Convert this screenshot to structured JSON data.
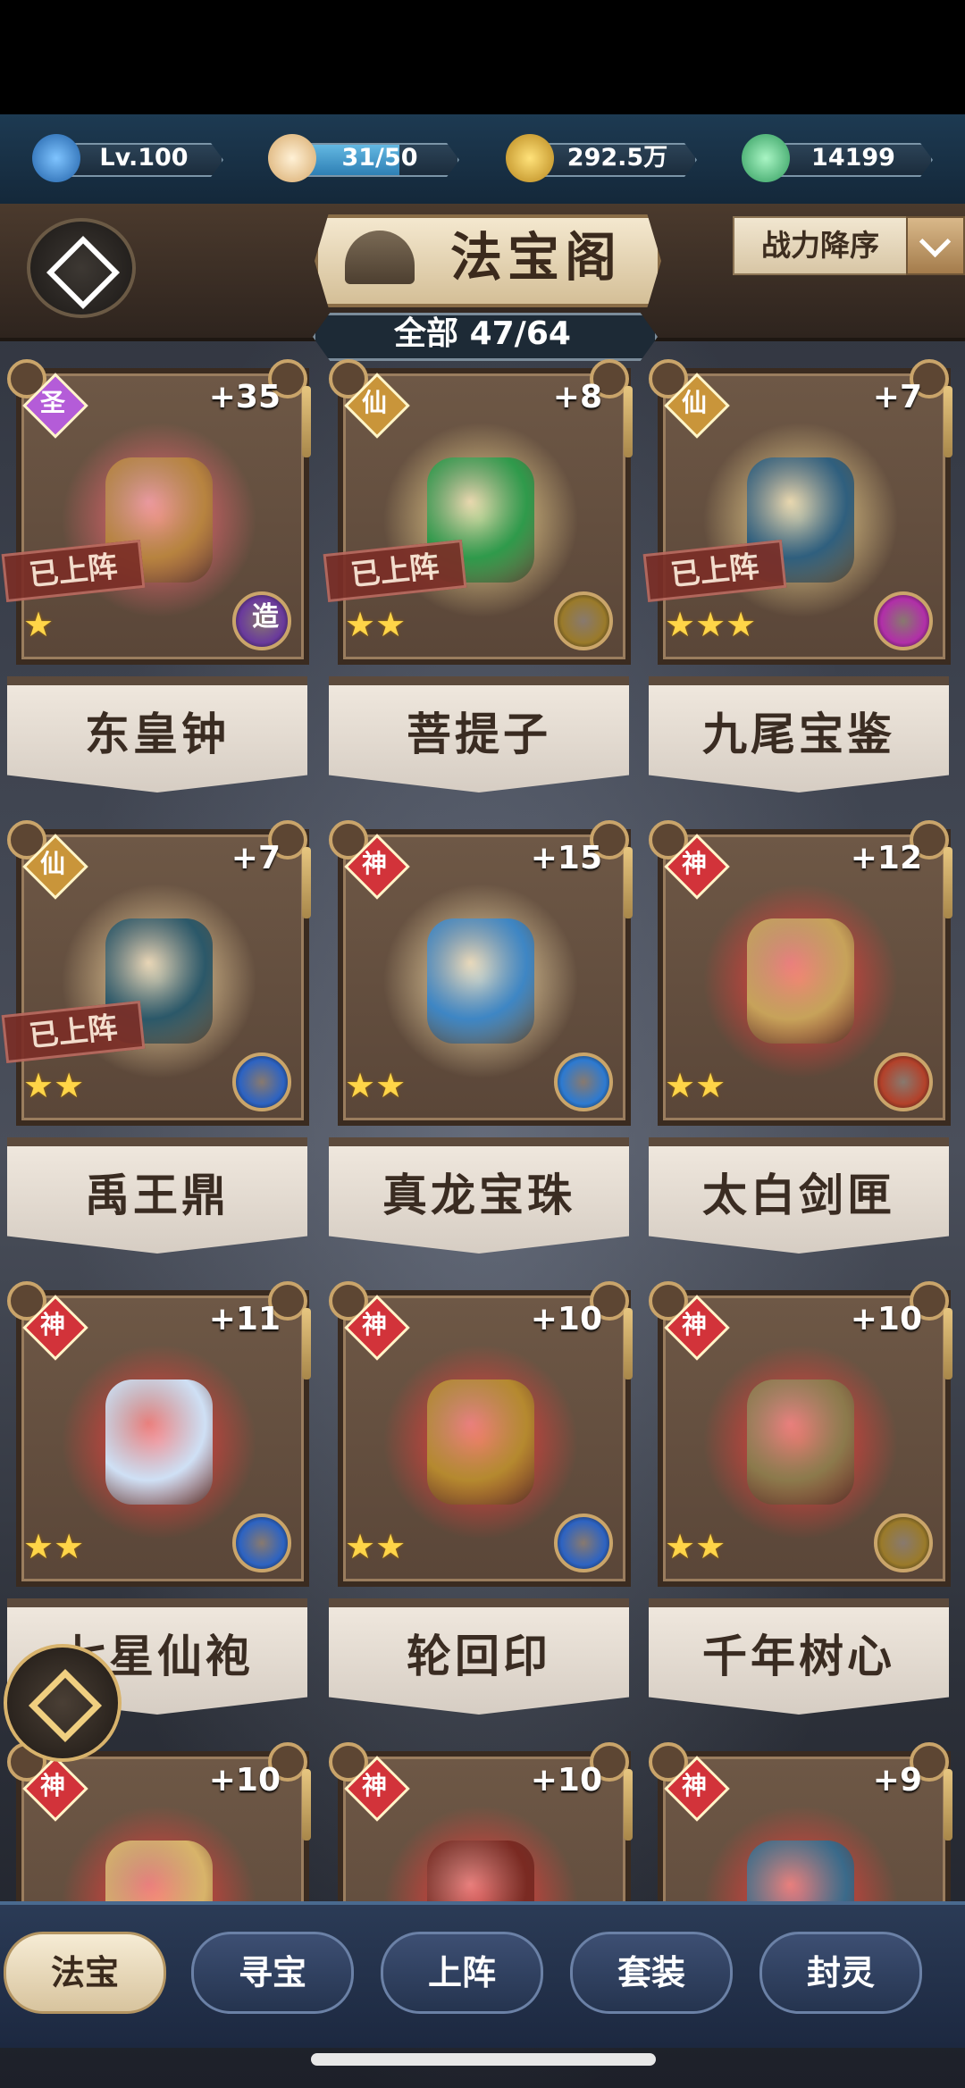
{
  "resources": [
    {
      "name": "level",
      "value": "Lv.100",
      "icon": "swirl-icon",
      "color": "#3e8ed6"
    },
    {
      "name": "stamina",
      "value": "31/50",
      "fill": 0.62,
      "icon": "bun-icon",
      "color": "#e6c08f"
    },
    {
      "name": "coins",
      "value": "292.5万",
      "icon": "coin-icon",
      "color": "#e7b83c"
    },
    {
      "name": "jade",
      "value": "14199",
      "icon": "leaf-icon",
      "color": "#4fbf7d"
    }
  ],
  "header": {
    "title": "法宝阁",
    "sort_label": "战力降序",
    "count_label": "全部 47/64"
  },
  "cards": [
    {
      "rank": "圣",
      "level": "+35",
      "name": "东皇钟",
      "stars": "★",
      "deployed": "已上阵",
      "skill": "造",
      "glow": "#ff6b7a",
      "item_color": "#b7833f",
      "rank_color": "#b45cd8",
      "skill_color": "#6a3a9c"
    },
    {
      "rank": "仙",
      "level": "+8",
      "name": "菩提子",
      "stars": "★★",
      "deployed": "已上阵",
      "skill": "",
      "glow": "#ffe39a",
      "item_color": "#2f9a4b",
      "rank_color": "#c9953a",
      "skill_color": "#9a7a2a"
    },
    {
      "rank": "仙",
      "level": "+7",
      "name": "九尾宝鉴",
      "stars": "★★★",
      "deployed": "已上阵",
      "skill": "",
      "glow": "#ffe39a",
      "item_color": "#2f5f7e",
      "rank_color": "#c9953a",
      "skill_color": "#b12fa8"
    },
    {
      "rank": "仙",
      "level": "+7",
      "name": "禹王鼎",
      "stars": "★★",
      "deployed": "已上阵",
      "skill": "",
      "glow": "#ffe0a8",
      "item_color": "#2b5869",
      "rank_color": "#c9953a",
      "skill_color": "#2d63c2"
    },
    {
      "rank": "神",
      "level": "+15",
      "name": "真龙宝珠",
      "stars": "★★",
      "deployed": "",
      "skill": "",
      "glow": "#ffe6b0",
      "item_color": "#3e86c4",
      "rank_color": "#d2333a",
      "skill_color": "#2d7ad1"
    },
    {
      "rank": "神",
      "level": "+12",
      "name": "太白剑匣",
      "stars": "★★",
      "deployed": "",
      "skill": "",
      "glow": "#ff3b3b",
      "item_color": "#c7a25a",
      "rank_color": "#d2333a",
      "skill_color": "#b3412a"
    },
    {
      "rank": "神",
      "level": "+11",
      "name": "七星仙袍",
      "stars": "★★",
      "deployed": "",
      "skill": "",
      "glow": "#ff3b3b",
      "item_color": "#cfe0f5",
      "rank_color": "#d2333a",
      "skill_color": "#2d63c2"
    },
    {
      "rank": "神",
      "level": "+10",
      "name": "轮回印",
      "stars": "★★",
      "deployed": "",
      "skill": "",
      "glow": "#ff3b3b",
      "item_color": "#b5892f",
      "rank_color": "#d2333a",
      "skill_color": "#2d63c2"
    },
    {
      "rank": "神",
      "level": "+10",
      "name": "千年树心",
      "stars": "★★",
      "deployed": "",
      "skill": "",
      "glow": "#ff3b3b",
      "item_color": "#8c7a4c",
      "rank_color": "#d2333a",
      "skill_color": "#9a7a2a"
    },
    {
      "rank": "神",
      "level": "+10",
      "name": "",
      "stars": "",
      "deployed": "",
      "skill": "",
      "glow": "#ff3b3b",
      "item_color": "#d8b46a",
      "rank_color": "#d2333a",
      "skill_color": ""
    },
    {
      "rank": "神",
      "level": "+10",
      "name": "",
      "stars": "",
      "deployed": "",
      "skill": "",
      "glow": "#ff3b3b",
      "item_color": "#7a2a22",
      "rank_color": "#d2333a",
      "skill_color": ""
    },
    {
      "rank": "神",
      "level": "+9",
      "name": "",
      "stars": "",
      "deployed": "",
      "skill": "",
      "glow": "#ff3b3b",
      "item_color": "#3a6a8a",
      "rank_color": "#d2333a",
      "skill_color": ""
    }
  ],
  "tabs": [
    {
      "label": "法宝",
      "active": true
    },
    {
      "label": "寻宝",
      "active": false
    },
    {
      "label": "上阵",
      "active": false
    },
    {
      "label": "套装",
      "active": false
    },
    {
      "label": "封灵",
      "active": false
    }
  ]
}
